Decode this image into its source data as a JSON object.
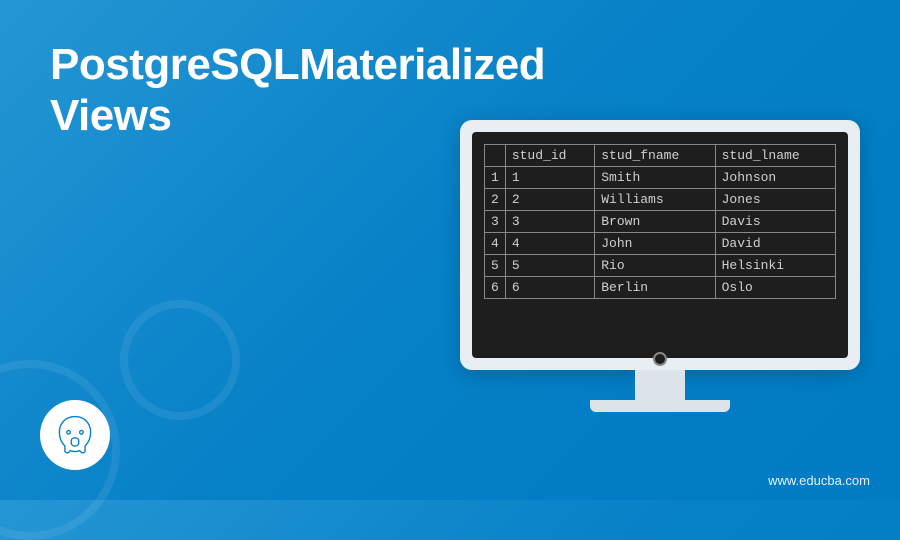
{
  "title_line1": "PostgreSQLMaterialized",
  "title_line2": "Views",
  "watermark": "www.educba.com",
  "table": {
    "headers": [
      "",
      "stud_id",
      "stud_fname",
      "stud_lname"
    ],
    "rows": [
      {
        "num": "1",
        "id": "1",
        "fname": "Smith",
        "lname": "Johnson"
      },
      {
        "num": "2",
        "id": "2",
        "fname": "Williams",
        "lname": "Jones"
      },
      {
        "num": "3",
        "id": "3",
        "fname": "Brown",
        "lname": "Davis"
      },
      {
        "num": "4",
        "id": "4",
        "fname": "John",
        "lname": "David"
      },
      {
        "num": "5",
        "id": "5",
        "fname": "Rio",
        "lname": "Helsinki"
      },
      {
        "num": "6",
        "id": "6",
        "fname": "Berlin",
        "lname": "Oslo"
      }
    ]
  }
}
